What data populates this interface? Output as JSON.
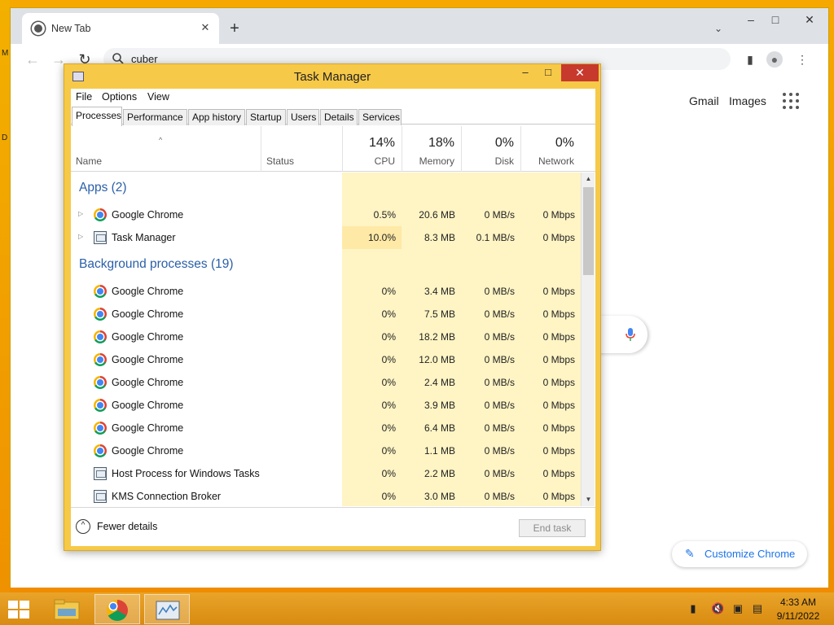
{
  "desktop": {
    "glyph1": "M",
    "glyph2": "D"
  },
  "browser": {
    "tab_title": "New Tab",
    "tab_close": "✕",
    "new_tab": "+",
    "window_controls": {
      "minimize": "–",
      "maximize": "□",
      "close": "✕"
    },
    "tab_search": "⌄",
    "omnibox_text": "cuber",
    "nav": {
      "back": "←",
      "forward": "→",
      "reload": "↻"
    },
    "toolbar_icons": {
      "side_panel": "▮",
      "profile": "●",
      "menu": "⋮"
    },
    "links": {
      "gmail": "Gmail",
      "images": "Images"
    },
    "customize_label": "Customize Chrome",
    "pencil_icon": "✎"
  },
  "task_manager": {
    "title": "Task Manager",
    "controls": {
      "minimize": "–",
      "maximize": "□",
      "close": "✕"
    },
    "menu": [
      "File",
      "Options",
      "View"
    ],
    "tabs": [
      "Processes",
      "Performance",
      "App history",
      "Startup",
      "Users",
      "Details",
      "Services"
    ],
    "columns": {
      "name": "Name",
      "status": "Status",
      "cpu": {
        "pct": "14%",
        "label": "CPU"
      },
      "memory": {
        "pct": "18%",
        "label": "Memory"
      },
      "disk": {
        "pct": "0%",
        "label": "Disk"
      },
      "network": {
        "pct": "0%",
        "label": "Network"
      }
    },
    "sort_arrow": "^",
    "groups": [
      {
        "label": "Apps (2)",
        "rows": [
          {
            "name": "Google Chrome",
            "icon": "chrome",
            "expand": true,
            "cpu": "0.5%",
            "memory": "20.6 MB",
            "disk": "0 MB/s",
            "network": "0 Mbps"
          },
          {
            "name": "Task Manager",
            "icon": "taskmgr",
            "expand": true,
            "cpu": "10.0%",
            "memory": "8.3 MB",
            "disk": "0.1 MB/s",
            "network": "0 Mbps"
          }
        ]
      },
      {
        "label": "Background processes (19)",
        "rows": [
          {
            "name": "Google Chrome",
            "icon": "chrome",
            "cpu": "0%",
            "memory": "3.4 MB",
            "disk": "0 MB/s",
            "network": "0 Mbps"
          },
          {
            "name": "Google Chrome",
            "icon": "chrome",
            "cpu": "0%",
            "memory": "7.5 MB",
            "disk": "0 MB/s",
            "network": "0 Mbps"
          },
          {
            "name": "Google Chrome",
            "icon": "chrome",
            "cpu": "0%",
            "memory": "18.2 MB",
            "disk": "0 MB/s",
            "network": "0 Mbps"
          },
          {
            "name": "Google Chrome",
            "icon": "chrome",
            "cpu": "0%",
            "memory": "12.0 MB",
            "disk": "0 MB/s",
            "network": "0 Mbps"
          },
          {
            "name": "Google Chrome",
            "icon": "chrome",
            "cpu": "0%",
            "memory": "2.4 MB",
            "disk": "0 MB/s",
            "network": "0 Mbps"
          },
          {
            "name": "Google Chrome",
            "icon": "chrome",
            "cpu": "0%",
            "memory": "3.9 MB",
            "disk": "0 MB/s",
            "network": "0 Mbps"
          },
          {
            "name": "Google Chrome",
            "icon": "chrome",
            "cpu": "0%",
            "memory": "6.4 MB",
            "disk": "0 MB/s",
            "network": "0 Mbps"
          },
          {
            "name": "Google Chrome",
            "icon": "chrome",
            "cpu": "0%",
            "memory": "1.1 MB",
            "disk": "0 MB/s",
            "network": "0 Mbps"
          },
          {
            "name": "Host Process for Windows Tasks",
            "icon": "window",
            "cpu": "0%",
            "memory": "2.2 MB",
            "disk": "0 MB/s",
            "network": "0 Mbps"
          },
          {
            "name": "KMS Connection Broker",
            "icon": "window",
            "cpu": "0%",
            "memory": "3.0 MB",
            "disk": "0 MB/s",
            "network": "0 Mbps"
          }
        ]
      }
    ],
    "scroll": {
      "up": "▲",
      "down": "▼"
    },
    "fewer_details_icon": "^",
    "fewer_details": "Fewer details",
    "end_task": "End task"
  },
  "taskbar": {
    "time": "4:33 AM",
    "date": "9/11/2022",
    "tray": {
      "flag": "▮",
      "volume": "🔇",
      "network": "▣",
      "power": "▤"
    }
  },
  "colors": {
    "cpu_highlight": "#ffe9a6",
    "cell_fill": "#fff4c4",
    "group_blue": "#2a5fa8",
    "tm_frame": "#f7c948",
    "close_red": "#c7392d"
  }
}
